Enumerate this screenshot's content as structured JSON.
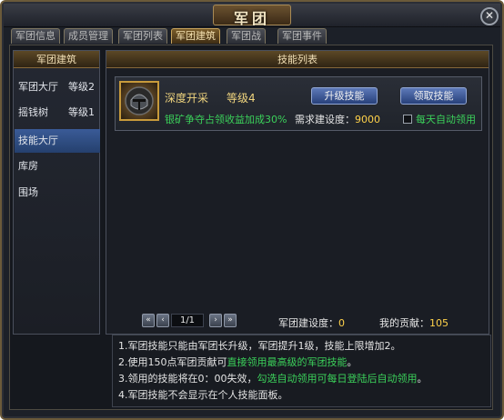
{
  "window": {
    "title": "军团"
  },
  "tabs": [
    {
      "label": "军团信息"
    },
    {
      "label": "成员管理"
    },
    {
      "label": "军团列表"
    },
    {
      "label": "军团建筑"
    },
    {
      "label": "军团战"
    },
    {
      "label": "军团事件"
    }
  ],
  "active_tab": "军团建筑",
  "sidebar": {
    "title": "军团建筑",
    "items": [
      {
        "label": "军团大厅",
        "level": "等级2"
      },
      {
        "label": "摇钱树",
        "level": "等级1"
      },
      {
        "label": "技能大厅",
        "level": ""
      },
      {
        "label": "库房",
        "level": ""
      },
      {
        "label": "围场",
        "level": ""
      }
    ],
    "active": "技能大厅"
  },
  "main": {
    "title": "技能列表",
    "skill": {
      "name": "深度开采",
      "level": "等级4",
      "description": "银矿争夺占领收益加成30%",
      "requirement_label": "需求建设度：",
      "requirement_value": "9000",
      "upgrade_button": "升级技能",
      "claim_button": "领取技能",
      "auto_claim_label": "每天自动领用",
      "auto_claim_checked": false
    },
    "pager": {
      "first": "«",
      "prev": "‹",
      "page": "1/1",
      "next": "›",
      "last": "»"
    },
    "stats": {
      "build_label": "军团建设度：",
      "build_value": "0",
      "contrib_label": "我的贡献：",
      "contrib_value": "105"
    }
  },
  "notes": {
    "line1": "1.军团技能只能由军团长升级，军团提升1级，技能上限增加2。",
    "line2_a": "2.使用150点军团贡献可",
    "line2_b": "直接领用最高级的军团技能",
    "line2_c": "。",
    "line3_a": "3.领用的技能将在0：00失效，",
    "line3_b": "勾选自动领用可每日登陆后自动领用",
    "line3_c": "。",
    "line4": "4.军团技能不会显示在个人技能面板。"
  },
  "colors": {
    "accent_gold": "#ffd24a",
    "accent_green": "#3bd15a",
    "button_blue": "#27407a",
    "selected_blue": "#2a4a84"
  }
}
